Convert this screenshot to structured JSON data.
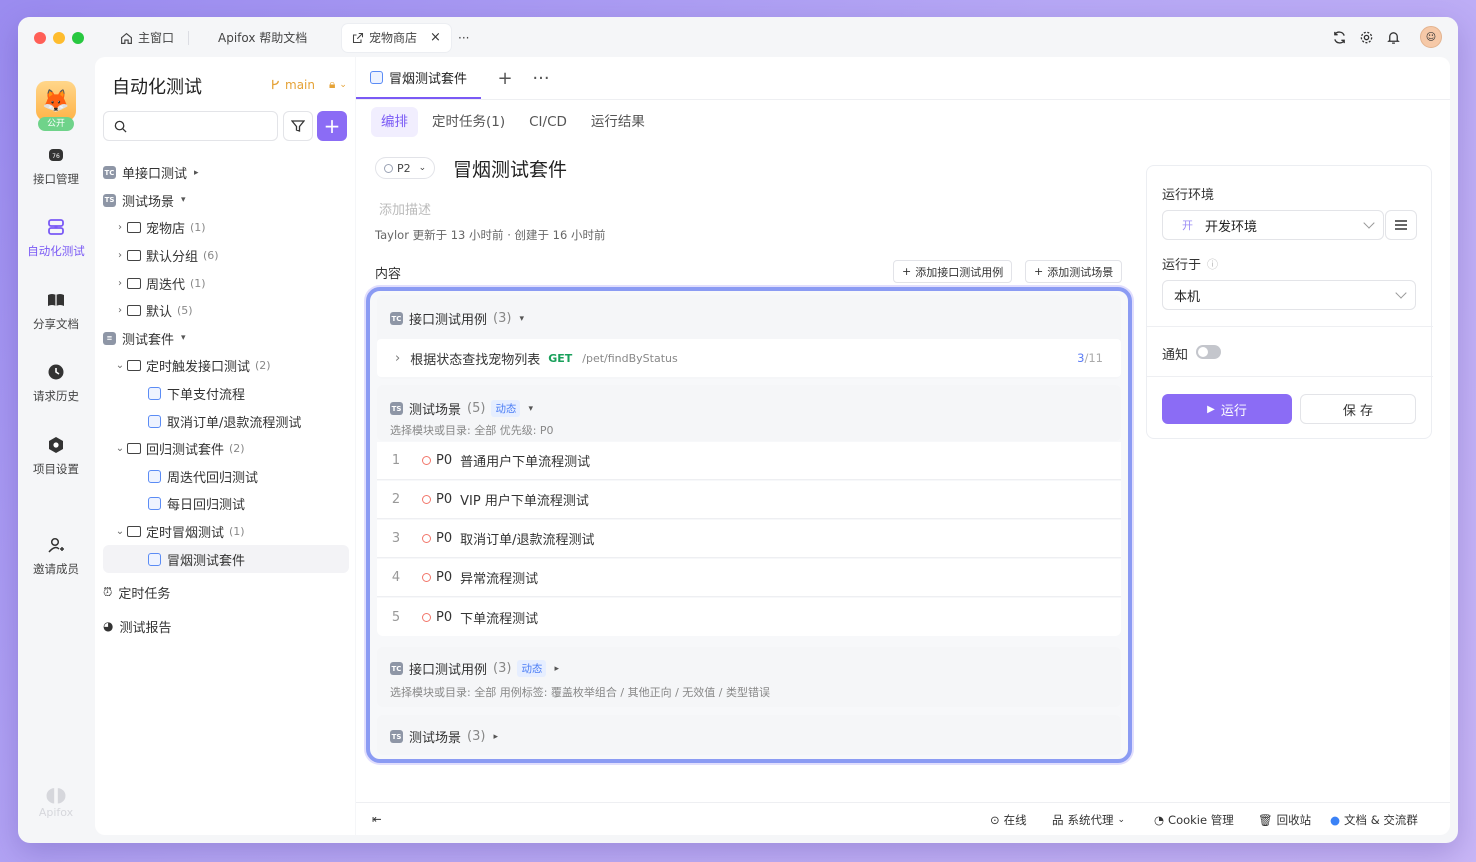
{
  "window_tabs": [
    {
      "label": "主窗口",
      "icon": "home-icon"
    },
    {
      "label": "Apifox 帮助文档"
    },
    {
      "label": "宠物商店",
      "icon": "external-link-icon",
      "active": true
    }
  ],
  "more_tabs": "···",
  "rail": {
    "public_badge": "公开",
    "items": [
      {
        "label": "接口管理",
        "icon": "api-icon"
      },
      {
        "label": "自动化测试",
        "icon": "automation-icon",
        "active": true
      },
      {
        "label": "分享文档",
        "icon": "book-icon"
      },
      {
        "label": "请求历史",
        "icon": "history-icon"
      },
      {
        "label": "项目设置",
        "icon": "settings-icon"
      },
      {
        "label": "邀请成员",
        "icon": "invite-user-icon"
      }
    ],
    "brand": "Apifox"
  },
  "sidebar": {
    "title": "自动化测试",
    "branch": "main",
    "tree": [
      {
        "label": "单接口测试",
        "type": "root",
        "badge": "TC",
        "caret": "▸"
      },
      {
        "label": "测试场景",
        "type": "root",
        "badge": "TS",
        "caret": "▾"
      },
      {
        "label": "宠物店",
        "count": "(1)",
        "type": "folder",
        "level": 1,
        "chev": "›"
      },
      {
        "label": "默认分组",
        "count": "(6)",
        "type": "folder",
        "level": 1,
        "chev": "›"
      },
      {
        "label": "周迭代",
        "count": "(1)",
        "type": "folder",
        "level": 1,
        "chev": "›"
      },
      {
        "label": "默认",
        "count": "(5)",
        "type": "folder",
        "level": 1,
        "chev": "›"
      },
      {
        "label": "测试套件",
        "type": "root",
        "badge": "suite",
        "caret": "▾"
      },
      {
        "label": "定时触发接口测试",
        "count": "(2)",
        "type": "folder",
        "level": 1,
        "chev": "⌄"
      },
      {
        "label": "下单支付流程",
        "type": "suite",
        "level": 2
      },
      {
        "label": "取消订单/退款流程测试",
        "type": "suite",
        "level": 2
      },
      {
        "label": "回归测试套件",
        "count": "(2)",
        "type": "folder",
        "level": 1,
        "chev": "⌄"
      },
      {
        "label": "周迭代回归测试",
        "type": "suite",
        "level": 2
      },
      {
        "label": "每日回归测试",
        "type": "suite",
        "level": 2
      },
      {
        "label": "定时冒烟测试",
        "count": "(1)",
        "type": "folder",
        "level": 1,
        "chev": "⌄"
      },
      {
        "label": "冒烟测试套件",
        "type": "suite",
        "level": 2,
        "selected": true
      },
      {
        "label": "定时任务",
        "type": "root",
        "badge": "alarm"
      },
      {
        "label": "测试报告",
        "type": "root",
        "badge": "pie"
      }
    ]
  },
  "main": {
    "tab_label": "冒烟测试套件",
    "subtabs": [
      "编排",
      "定时任务(1)",
      "CI/CD",
      "运行结果"
    ],
    "priority": "P2",
    "title": "冒烟测试套件",
    "description_placeholder": "添加描述",
    "meta": "Taylor 更新于 13 小时前 · 创建于 16 小时前",
    "content_label": "内容",
    "add_case_label": "添加接口测试用例",
    "add_scene_label": "添加测试场景",
    "blocks": {
      "b1_title": "接口测试用例",
      "b1_count": "(3)",
      "api_name": "根据状态查找宠物列表",
      "api_method": "GET",
      "api_path": "/pet/findByStatus",
      "api_ratio_done": "3",
      "api_ratio_total": "/11",
      "b2_title": "测试场景",
      "b2_count": "(5)",
      "dynamic": "动态",
      "b2_filter": "选择模块或目录: 全部    优先级: P0",
      "scenes": [
        {
          "no": "1",
          "p": "P0",
          "name": "普通用户下单流程测试"
        },
        {
          "no": "2",
          "p": "P0",
          "name": "VIP 用户下单流程测试"
        },
        {
          "no": "3",
          "p": "P0",
          "name": "取消订单/退款流程测试"
        },
        {
          "no": "4",
          "p": "P0",
          "name": "异常流程测试"
        },
        {
          "no": "5",
          "p": "P0",
          "name": "下单流程测试"
        }
      ],
      "b3_title": "接口测试用例",
      "b3_count": "(3)",
      "b3_filter": "选择模块或目录: 全部    用例标签: 覆盖枚举组合 / 其他正向 / 无效值 / 类型错误",
      "b4_title": "测试场景",
      "b4_count": "(3)"
    }
  },
  "run_panel": {
    "env_label": "运行环境",
    "env_prefix": "开",
    "env_value": "开发环境",
    "run_on_label": "运行于",
    "run_on_value": "本机",
    "notify_label": "通知",
    "notify_on": false,
    "run_label": "运行",
    "save_label": "保 存"
  },
  "status_bar": {
    "online": "在线",
    "proxy": "系统代理",
    "cookie": "Cookie 管理",
    "trash": "回收站",
    "docs": "文档 & 交流群"
  },
  "colors": {
    "accent": "#8b6cf5",
    "highlight_frame": "#8b9bf3",
    "get": "#19a05b",
    "priority_dot": "#f2766a"
  }
}
